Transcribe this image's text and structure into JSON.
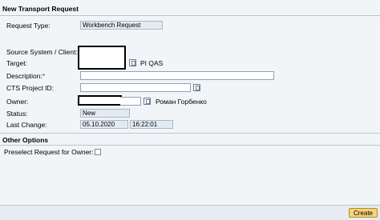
{
  "header": {
    "title": "New Transport Request"
  },
  "form": {
    "request_type": {
      "label": "Request Type:",
      "value": "Workbench Request"
    },
    "source_system": {
      "label": "Source System / Client:",
      "value": ""
    },
    "target": {
      "label": "Target:",
      "value": "",
      "desc": "PI QAS"
    },
    "description": {
      "label": "Description:",
      "required_mark": "*",
      "value": ""
    },
    "cts_project": {
      "label": "CTS Project ID:",
      "value": ""
    },
    "owner": {
      "label": "Owner:",
      "value": "",
      "desc": "Роман Горбенко"
    },
    "status": {
      "label": "Status:",
      "value": "New"
    },
    "last_change": {
      "label": "Last Change:",
      "date": "05.10.2020",
      "time": "16:22:01"
    }
  },
  "other_options": {
    "title": "Other Options",
    "preselect_label": "Preselect Request for Owner:",
    "preselect_checked": false
  },
  "footer": {
    "create_label": "Create"
  },
  "colors": {
    "accent_button": "#f6d27a",
    "redaction": "#000000"
  }
}
